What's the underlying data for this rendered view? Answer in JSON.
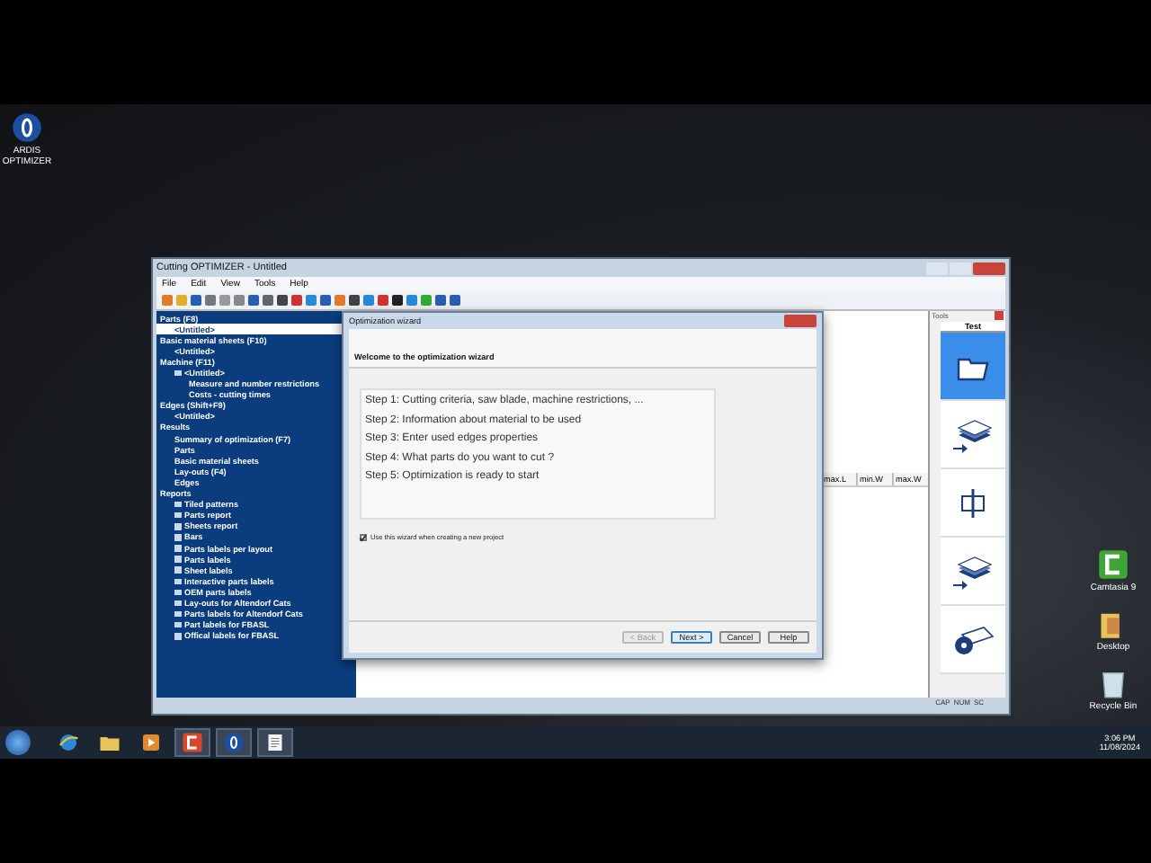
{
  "desktop_icons": [
    {
      "kind": "optimizer",
      "label": "ARDIS OPTIMIZER"
    },
    {
      "kind": "camtasia",
      "label": "Camtasia 9"
    },
    {
      "kind": "folder",
      "label": "Desktop"
    },
    {
      "kind": "bin",
      "label": "Recycle Bin"
    }
  ],
  "window": {
    "title": "Cutting OPTIMIZER - Untitled",
    "menu": [
      "File",
      "Edit",
      "View",
      "Tools",
      "Help"
    ],
    "tree": [
      {
        "label": "Parts (F8)",
        "icon": false,
        "selected": false,
        "children": [
          {
            "label": "<Untitled>",
            "icon": false,
            "selected": true
          }
        ]
      },
      {
        "label": "Basic material sheets (F10)",
        "icon": false,
        "selected": false,
        "children": [
          {
            "label": "<Untitled>",
            "icon": false,
            "selected": false
          }
        ]
      },
      {
        "label": "Machine (F11)",
        "icon": false,
        "selected": false,
        "children": [
          {
            "label": "<Untitled>",
            "icon": true,
            "selected": false,
            "children": [
              {
                "label": "Measure and number restrictions",
                "icon": false,
                "selected": false
              },
              {
                "label": "Costs - cutting times",
                "icon": false,
                "selected": false
              }
            ]
          }
        ]
      },
      {
        "label": "Edges (Shift+F9)",
        "icon": false,
        "selected": false,
        "children": [
          {
            "label": "<Untitled>",
            "icon": false,
            "selected": false
          }
        ]
      },
      {
        "label": "Results",
        "icon": false,
        "selected": false,
        "children": [
          {
            "label": "Summary of optimization (F7)",
            "icon": false,
            "selected": false
          },
          {
            "label": "Parts",
            "icon": false,
            "selected": false
          },
          {
            "label": "Basic material sheets",
            "icon": false,
            "selected": false
          },
          {
            "label": "Lay-outs (F4)",
            "icon": false,
            "selected": false
          },
          {
            "label": "Edges",
            "icon": false,
            "selected": false
          }
        ]
      },
      {
        "label": "Reports",
        "icon": false,
        "selected": false,
        "children": [
          {
            "label": "Tiled patterns",
            "icon": true,
            "selected": false
          },
          {
            "label": "Parts report",
            "icon": true,
            "selected": false
          },
          {
            "label": "Sheets report",
            "icon": true,
            "selected": false
          },
          {
            "label": "Bars",
            "icon": true,
            "selected": false
          },
          {
            "label": "Parts labels per layout",
            "icon": true,
            "selected": false
          },
          {
            "label": "Parts labels",
            "icon": true,
            "selected": false
          },
          {
            "label": "Sheet labels",
            "icon": true,
            "selected": false
          },
          {
            "label": "Interactive parts labels",
            "icon": true,
            "selected": false
          },
          {
            "label": "OEM parts labels",
            "icon": true,
            "selected": false
          },
          {
            "label": "Lay-outs for Altendorf Cats",
            "icon": true,
            "selected": false
          },
          {
            "label": "Parts labels for Altendorf Cats",
            "icon": true,
            "selected": false
          },
          {
            "label": "Part labels for FBASL",
            "icon": true,
            "selected": false
          },
          {
            "label": "Offical labels for FBASL",
            "icon": true,
            "selected": false
          }
        ]
      }
    ],
    "table": {
      "columns": [
        "max.L",
        "min.W",
        "max.W"
      ]
    },
    "tools": {
      "title": "Tools",
      "column": "Test",
      "items": [
        {
          "kind": "folder",
          "selected": true
        },
        {
          "kind": "sheets",
          "selected": false
        },
        {
          "kind": "part",
          "selected": false
        },
        {
          "kind": "sheets",
          "selected": false
        },
        {
          "kind": "edge",
          "selected": false
        }
      ]
    },
    "status_bar": [
      "CAP",
      "NUM",
      "SC"
    ]
  },
  "dialog": {
    "title": "Optimization wizard",
    "heading": "Welcome to the optimization wizard",
    "steps": [
      "Step 1: Cutting criteria, saw blade, machine restrictions, ...",
      "Step 2: Information about material to be used",
      "Step 3: Enter used edges properties",
      "Step 4: What parts do you want to cut ?",
      "Step 5: Optimization is ready to start"
    ],
    "checkbox": {
      "label": "Use this wizard when creating a new project",
      "checked": true
    },
    "buttons": [
      {
        "label": "< Back",
        "disabled": true
      },
      {
        "label": "Next >",
        "disabled": false
      },
      {
        "label": "Cancel",
        "disabled": false
      },
      {
        "label": "Help",
        "disabled": false
      }
    ]
  },
  "taskbar": {
    "apps": [
      {
        "kind": "ie"
      },
      {
        "kind": "folder"
      },
      {
        "kind": "media"
      },
      {
        "kind": "camtasia"
      },
      {
        "kind": "optimizer"
      },
      {
        "kind": "notepad"
      }
    ],
    "time": "3:06 PM",
    "date": "11/08/2024"
  }
}
